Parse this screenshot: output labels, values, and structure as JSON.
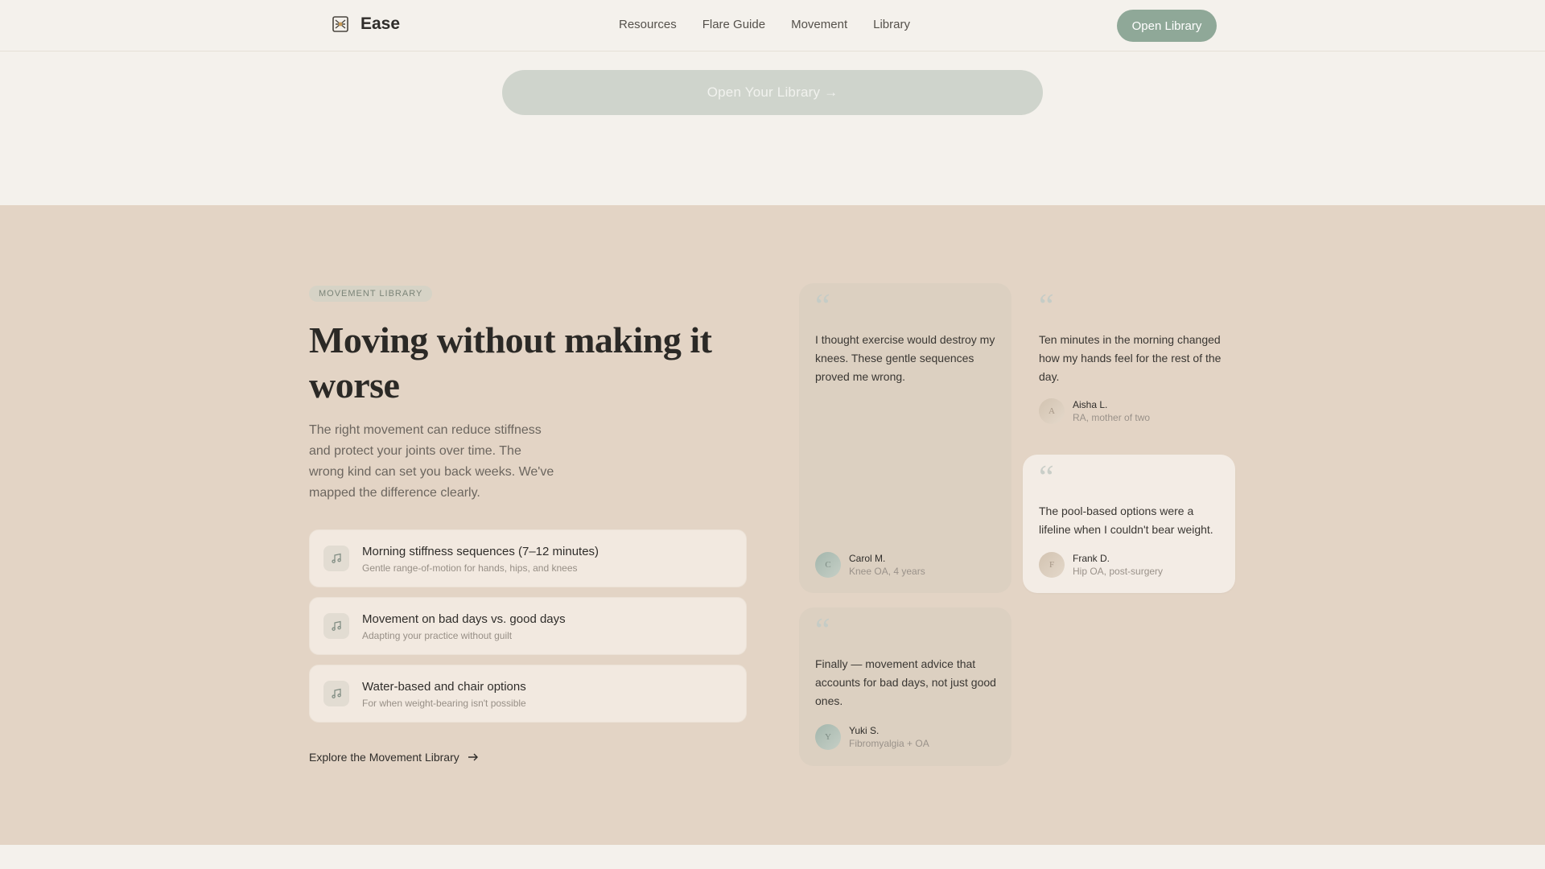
{
  "header": {
    "brand": "Ease",
    "nav": [
      "Resources",
      "Flare Guide",
      "Movement",
      "Library"
    ],
    "cta": "Open Library"
  },
  "top_cta": "Open Your Library →",
  "section": {
    "eyebrow": "MOVEMENT LIBRARY",
    "title": "Moving without making it worse",
    "description": "The right movement can reduce stiffness and protect your joints over time. The wrong kind can set you back weeks. We've mapped the difference clearly.",
    "features": [
      {
        "title": "Morning stiffness sequences (7–12 minutes)",
        "subtitle": "Gentle range-of-motion for hands, hips, and knees",
        "icon": "music-note-icon"
      },
      {
        "title": "Movement on bad days vs. good days",
        "subtitle": "Adapting your practice without guilt",
        "icon": "music-note-icon"
      },
      {
        "title": "Water-based and chair options",
        "subtitle": "For when weight-bearing isn't possible",
        "icon": "music-note-icon"
      }
    ],
    "explore_link": "Explore the Movement Library"
  },
  "testimonials": [
    {
      "quote": "I thought exercise would destroy my knees. These gentle sequences proved me wrong.",
      "name": "Carol M.",
      "meta": "Knee OA, 4 years",
      "initial": "C"
    },
    {
      "quote": "Finally — movement advice that accounts for bad days, not just good ones.",
      "name": "Yuki S.",
      "meta": "Fibromyalgia + OA",
      "initial": "Y"
    },
    {
      "quote": "Ten minutes in the morning changed how my hands feel for the rest of the day.",
      "name": "Aisha L.",
      "meta": "RA, mother of two",
      "initial": "A"
    },
    {
      "quote": "The pool-based options were a lifeline when I couldn't bear weight.",
      "name": "Frank D.",
      "meta": "Hip OA, post-surgery",
      "initial": "F"
    }
  ],
  "colors": {
    "accent": "#8fa898",
    "section_bg": "#e3d4c5",
    "page_bg": "#f4f1ec"
  }
}
